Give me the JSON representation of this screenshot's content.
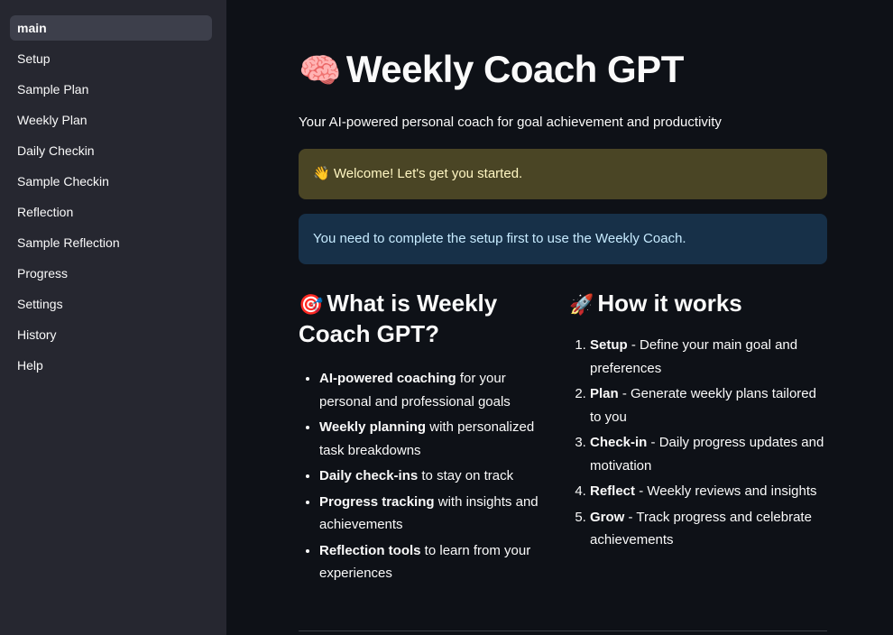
{
  "sidebar": {
    "items": [
      {
        "label": "main"
      },
      {
        "label": "Setup"
      },
      {
        "label": "Sample Plan"
      },
      {
        "label": "Weekly Plan"
      },
      {
        "label": "Daily Checkin"
      },
      {
        "label": "Sample Checkin"
      },
      {
        "label": "Reflection"
      },
      {
        "label": "Sample Reflection"
      },
      {
        "label": "Progress"
      },
      {
        "label": "Settings"
      },
      {
        "label": "History"
      },
      {
        "label": "Help"
      }
    ]
  },
  "header": {
    "emoji": "🧠",
    "title": "Weekly Coach GPT",
    "subtitle": "Your AI-powered personal coach for goal achievement and productivity"
  },
  "alerts": {
    "welcome": "👋 Welcome! Let's get you started.",
    "setup_required": "You need to complete the setup first to use the Weekly Coach."
  },
  "what_is": {
    "emoji": "🎯",
    "heading": "What is Weekly Coach GPT?",
    "items": [
      {
        "bold": "AI-powered coaching",
        "text": " for your personal and professional goals"
      },
      {
        "bold": "Weekly planning",
        "text": " with personalized task breakdowns"
      },
      {
        "bold": "Daily check-ins",
        "text": " to stay on track"
      },
      {
        "bold": "Progress tracking",
        "text": " with insights and achievements"
      },
      {
        "bold": "Reflection tools",
        "text": " to learn from your experiences"
      }
    ]
  },
  "how_it_works": {
    "emoji": "🚀",
    "heading": "How it works",
    "items": [
      {
        "bold": "Setup",
        "text": " - Define your main goal and preferences"
      },
      {
        "bold": "Plan",
        "text": " - Generate weekly plans tailored to you"
      },
      {
        "bold": "Check-in",
        "text": " - Daily progress updates and motivation"
      },
      {
        "bold": "Reflect",
        "text": " - Weekly reviews and insights"
      },
      {
        "bold": "Grow",
        "text": " - Track progress and celebrate achievements"
      }
    ]
  },
  "colors": {
    "background": "#0e1117",
    "sidebar": "#262730",
    "active_item": "#3d3f4b",
    "warning_bg": "#4a4525",
    "info_bg": "#173048"
  }
}
